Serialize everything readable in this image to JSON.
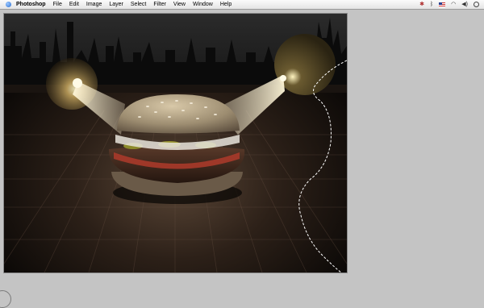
{
  "menubar": {
    "app_name": "Photoshop",
    "items": [
      "File",
      "Edit",
      "Image",
      "Layer",
      "Select",
      "Filter",
      "View",
      "Window",
      "Help"
    ],
    "status_icons": [
      "bug-icon",
      "bluetooth-icon",
      "us-flag-icon",
      "wifi-icon",
      "volume-icon",
      "clock-icon"
    ]
  },
  "canvas": {
    "content": "burger-spotlight-artwork",
    "selection_marquee": true
  },
  "colors": {
    "menubar_bg": "#ececec",
    "workspace_bg": "#c4c4c4",
    "canvas_bg": "#0f0b08"
  }
}
